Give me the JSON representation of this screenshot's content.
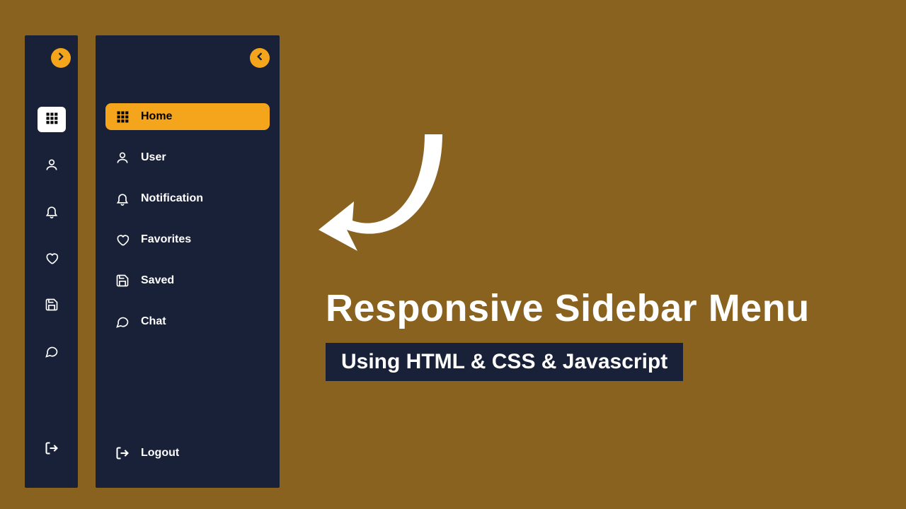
{
  "colors": {
    "bg": "#8a6220",
    "panel": "#182138",
    "accent": "#f4a51c"
  },
  "sidebar": {
    "items": [
      {
        "key": "home",
        "label": "Home",
        "icon": "grid-icon",
        "active": true
      },
      {
        "key": "user",
        "label": "User",
        "icon": "user-icon",
        "active": false
      },
      {
        "key": "notification",
        "label": "Notification",
        "icon": "bell-icon",
        "active": false
      },
      {
        "key": "favorites",
        "label": "Favorites",
        "icon": "heart-icon",
        "active": false
      },
      {
        "key": "saved",
        "label": "Saved",
        "icon": "save-icon",
        "active": false
      },
      {
        "key": "chat",
        "label": "Chat",
        "icon": "chat-icon",
        "active": false
      }
    ],
    "logout": {
      "label": "Logout",
      "icon": "logout-icon"
    }
  },
  "hero": {
    "title": "Responsive Sidebar Menu",
    "subtitle": "Using HTML & CSS & Javascript"
  }
}
